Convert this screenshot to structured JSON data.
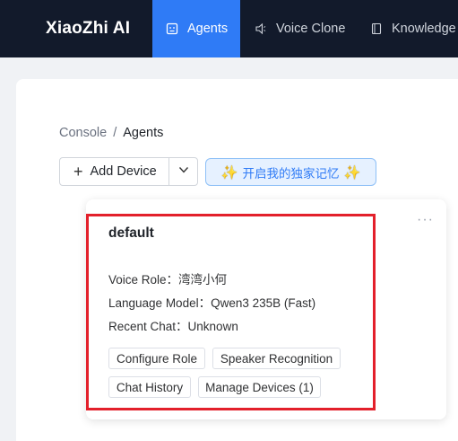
{
  "header": {
    "brand": "XiaoZhi AI",
    "tabs": [
      {
        "label": "Agents",
        "icon": "robot-icon",
        "active": true
      },
      {
        "label": "Voice Clone",
        "icon": "speaker-icon",
        "active": false
      },
      {
        "label": "Knowledge B",
        "icon": "book-icon",
        "active": false
      }
    ]
  },
  "breadcrumb": {
    "root": "Console",
    "separator": "/",
    "current": "Agents"
  },
  "toolbar": {
    "add_device_label": "Add Device",
    "memory_label": "开启我的独家记忆",
    "memory_icon": "sparkle-icon"
  },
  "agent_card": {
    "title": "default",
    "voice_role": "Voice Role：湾湾小何",
    "language_model": "Language Model：Qwen3 235B (Fast)",
    "recent_chat": "Recent Chat：Unknown",
    "buttons": {
      "configure_role": "Configure Role",
      "speaker_recognition": "Speaker Recognition",
      "chat_history": "Chat History",
      "manage_devices": "Manage Devices (1)"
    },
    "highlight_color": "#e3202b"
  },
  "colors": {
    "topbar": "#121a2b",
    "accent": "#2f7bf6"
  }
}
